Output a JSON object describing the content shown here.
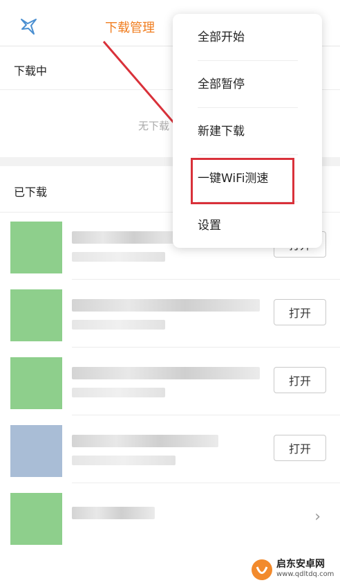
{
  "header": {
    "title": "下载管理",
    "logo_icon": "bird-icon"
  },
  "downloading": {
    "title": "下载中",
    "empty_text": "无下载"
  },
  "downloaded": {
    "title": "已下载",
    "items": [
      {
        "action_label": "打开",
        "thumb_color": "#8ecf8c"
      },
      {
        "action_label": "打开",
        "thumb_color": "#8ecf8c"
      },
      {
        "action_label": "打开",
        "thumb_color": "#8ecf8c"
      },
      {
        "action_label": "打开",
        "thumb_color": "#a9bdd6"
      },
      {
        "action_label": "",
        "thumb_color": "#8ecf8c"
      }
    ]
  },
  "menu": {
    "items": [
      "全部开始",
      "全部暂停",
      "新建下载",
      "一键WiFi测速",
      "设置"
    ]
  },
  "watermark": {
    "line1": "启东安卓网",
    "line2": "www.qdltdq.com"
  },
  "colors": {
    "accent": "#f07d1f",
    "highlight": "#d9313a"
  }
}
